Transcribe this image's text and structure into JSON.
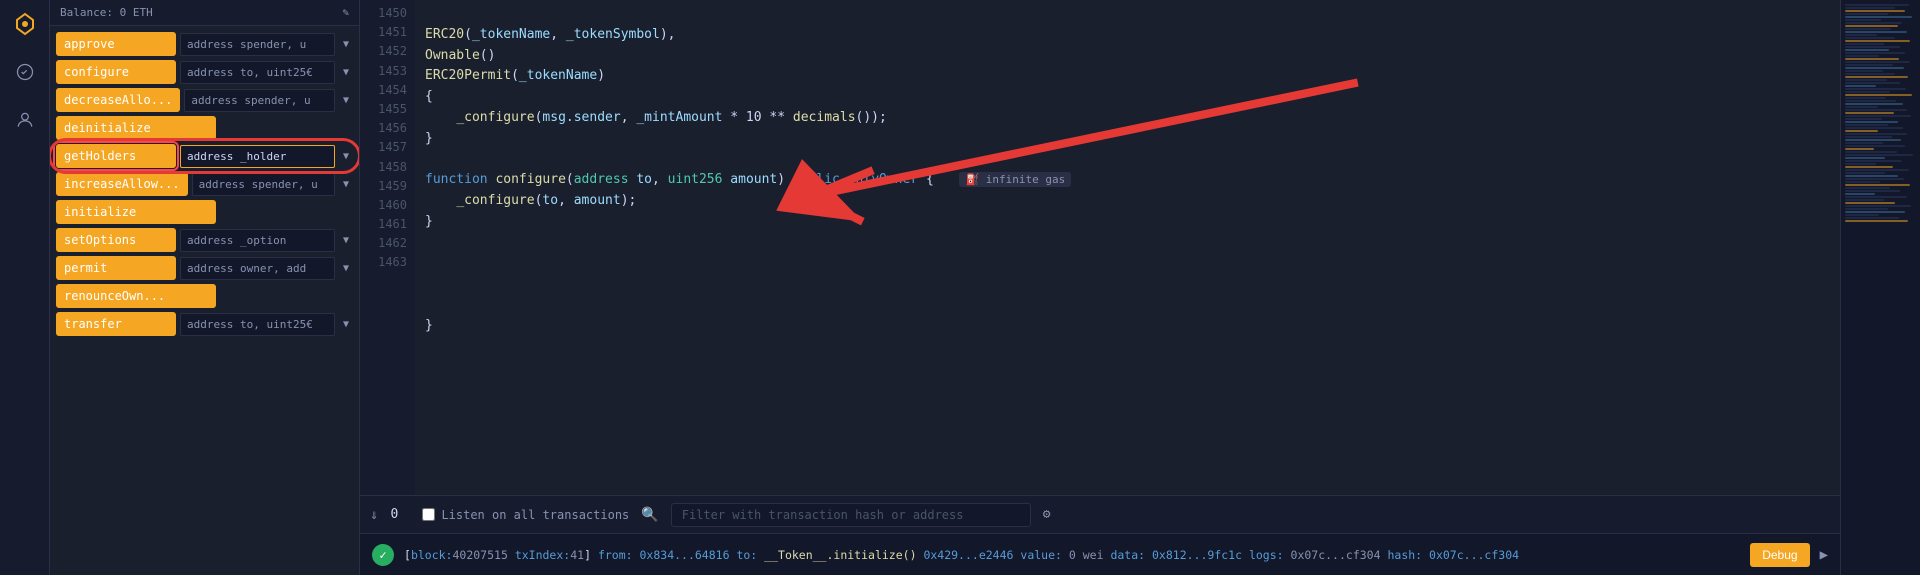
{
  "sidebar": {
    "balance_label": "Balance: 0 ETH",
    "icons": [
      {
        "name": "logo-icon",
        "symbol": "◈"
      },
      {
        "name": "deploy-icon",
        "symbol": "🔧"
      },
      {
        "name": "interact-icon",
        "symbol": "👤"
      }
    ]
  },
  "functions": {
    "header": {
      "balance": "Balance: 0 ETH"
    },
    "items": [
      {
        "id": "approve",
        "label": "approve",
        "param": "address spender, u",
        "has_dropdown": true
      },
      {
        "id": "configure",
        "label": "configure",
        "param": "address to, uint25€",
        "has_dropdown": true
      },
      {
        "id": "decreaseAllo",
        "label": "decreaseAllo...",
        "param": "address spender, u",
        "has_dropdown": true
      },
      {
        "id": "deinitialize",
        "label": "deinitialize",
        "param": null,
        "has_dropdown": false
      },
      {
        "id": "getHolders",
        "label": "getHolders",
        "param": "address _holder",
        "has_dropdown": true,
        "highlighted": true
      },
      {
        "id": "increaseAllow",
        "label": "increaseAllow...",
        "param": "address spender, u",
        "has_dropdown": true
      },
      {
        "id": "initialize",
        "label": "initialize",
        "param": null,
        "has_dropdown": false
      },
      {
        "id": "setOptions",
        "label": "setOptions",
        "param": "address _option",
        "has_dropdown": true
      },
      {
        "id": "permit",
        "label": "permit",
        "param": "address owner, add",
        "has_dropdown": true
      },
      {
        "id": "renounceOwn",
        "label": "renounceOwn...",
        "param": null,
        "has_dropdown": false
      },
      {
        "id": "transfer",
        "label": "transfer",
        "param": "address to, uint25€",
        "has_dropdown": true
      }
    ]
  },
  "code": {
    "lines": [
      {
        "num": 1450,
        "content": "ERC20(_tokenName, _tokenSymbol),"
      },
      {
        "num": 1451,
        "content": "Ownable()"
      },
      {
        "num": 1452,
        "content": "ERC20Permit(_tokenName)"
      },
      {
        "num": 1453,
        "content": "{"
      },
      {
        "num": 1454,
        "content": "    _configure(msg.sender, _mintAmount * 10 ** decimals());"
      },
      {
        "num": 1455,
        "content": "}"
      },
      {
        "num": 1456,
        "content": ""
      },
      {
        "num": 1457,
        "content": "function configure(address to, uint256 amount) public onlyOwner {",
        "has_gas": true
      },
      {
        "num": 1458,
        "content": "    _configure(to, amount);"
      },
      {
        "num": 1459,
        "content": "}"
      },
      {
        "num": 1460,
        "content": ""
      },
      {
        "num": 1461,
        "content": ""
      },
      {
        "num": 1462,
        "content": ""
      },
      {
        "num": 1463,
        "content": "}"
      }
    ]
  },
  "bottom_toolbar": {
    "collapse_symbol": "⇓",
    "transaction_count": "0",
    "listen_label": "Listen on all transactions",
    "filter_placeholder": "Filter with transaction hash or address",
    "settings_symbol": "⚙"
  },
  "tx_log": {
    "block": "40207515",
    "tx_index": "41",
    "from": "0x834...64816",
    "to": "__Token__.initialize()",
    "value_eth": "0x429...e2446",
    "wei_val": "0",
    "data": "0x812...9fc1c",
    "logs": "0x07c...cf304",
    "debug_label": "Debug"
  },
  "gas_badge_text": "⛽ infinite gas"
}
